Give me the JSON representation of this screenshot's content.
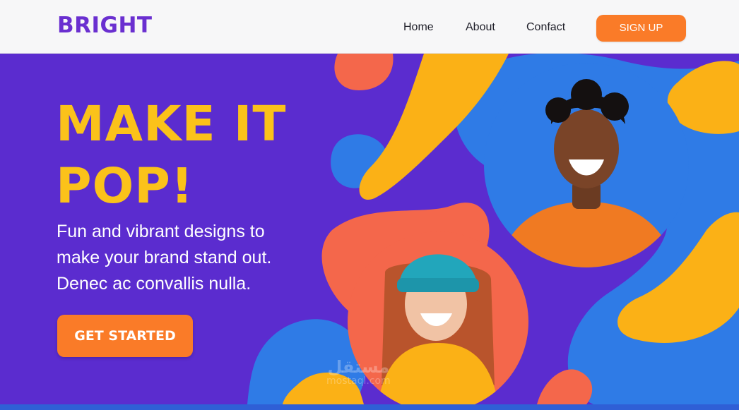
{
  "nav": {
    "logo": "BRIGHT",
    "links": [
      "Home",
      "About",
      "Confact"
    ],
    "signup_label": "SIGN UP"
  },
  "hero": {
    "title_lines": [
      "MAKE IT",
      "POP!"
    ],
    "subtitle_lines": [
      "Fun and vibrant designs to",
      "make your brand stand out.",
      "Denec ac convallis nulla."
    ],
    "cta_label": "GET STARTED",
    "photos": [
      "smiling-young-man-photo",
      "smiling-young-woman-photo"
    ]
  },
  "watermark": {
    "arabic": "مستقل",
    "latin": "mostaql.com"
  },
  "colors": {
    "brand_purple": "#6a2fd0",
    "hero_purple": "#5b2ccf",
    "accent_orange": "#fa7b28",
    "title_yellow": "#fbc21a",
    "blob_blue": "#2f7be6",
    "blob_coral": "#f4674b"
  }
}
